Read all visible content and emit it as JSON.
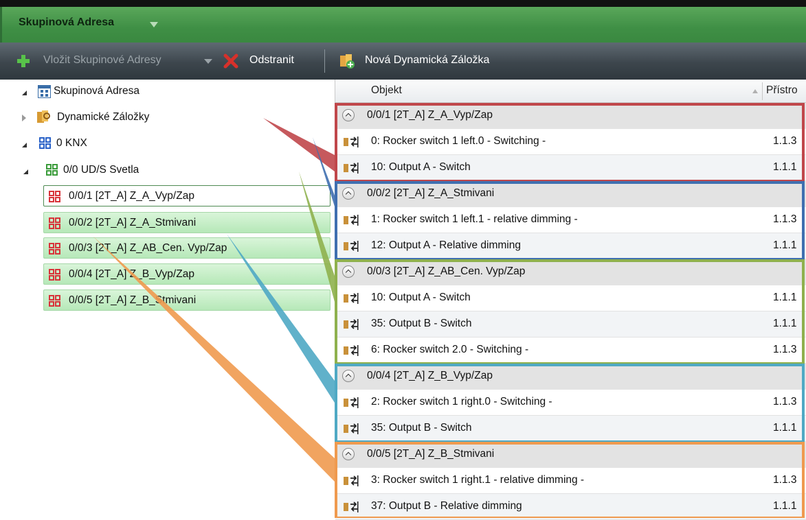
{
  "panel": {
    "title": "Skupinová Adresa"
  },
  "toolbar": {
    "insert_label": "Vložit Skupinové Adresy",
    "delete_label": "Odstranit",
    "new_tab_label": "Nová Dynamická Záložka"
  },
  "tree": {
    "root_label": "Skupinová Adresa",
    "dynamic_label": "Dynamické Záložky",
    "knx_label": "0 KNX",
    "middle_label": "0/0 UD/S Svetla",
    "group_addresses": [
      "0/0/1 [2T_A] Z_A_Vyp/Zap",
      "0/0/2 [2T_A] Z_A_Stmivani",
      "0/0/3 [2T_A] Z_AB_Cen. Vyp/Zap",
      "0/0/4 [2T_A] Z_B_Vyp/Zap",
      "0/0/5 [2T_A] Z_B_Stmivani"
    ]
  },
  "table": {
    "col_object": "Objekt",
    "col_device": "Přístro",
    "groups": [
      {
        "label": "0/0/1 [2T_A] Z_A_Vyp/Zap",
        "rows": [
          {
            "object": "0: Rocker switch 1 left.0 - Switching -",
            "device": "1.1.3"
          },
          {
            "object": "10: Output A - Switch",
            "device": "1.1.1"
          }
        ]
      },
      {
        "label": "0/0/2 [2T_A] Z_A_Stmivani",
        "rows": [
          {
            "object": "1: Rocker switch 1 left.1 - relative dimming -",
            "device": "1.1.3"
          },
          {
            "object": "12: Output A - Relative dimming",
            "device": "1.1.1"
          }
        ]
      },
      {
        "label": "0/0/3 [2T_A] Z_AB_Cen. Vyp/Zap",
        "rows": [
          {
            "object": "10: Output A - Switch",
            "device": "1.1.1"
          },
          {
            "object": "35: Output B - Switch",
            "device": "1.1.1"
          },
          {
            "object": "6: Rocker switch 2.0 - Switching -",
            "device": "1.1.3"
          }
        ]
      },
      {
        "label": "0/0/4 [2T_A] Z_B_Vyp/Zap",
        "rows": [
          {
            "object": "2: Rocker switch 1 right.0 - Switching -",
            "device": "1.1.3"
          },
          {
            "object": "35: Output B - Switch",
            "device": "1.1.1"
          }
        ]
      },
      {
        "label": "0/0/5 [2T_A] Z_B_Stmivani",
        "rows": [
          {
            "object": "3: Rocker switch 1 right.1 - relative dimming -",
            "device": "1.1.3"
          },
          {
            "object": "37: Output B - Relative dimming",
            "device": "1.1.1"
          }
        ]
      }
    ]
  },
  "annotation_colors": [
    "#c0474b",
    "#3f6fb0",
    "#8fb14e",
    "#4fa9c4",
    "#ef9a4f"
  ]
}
